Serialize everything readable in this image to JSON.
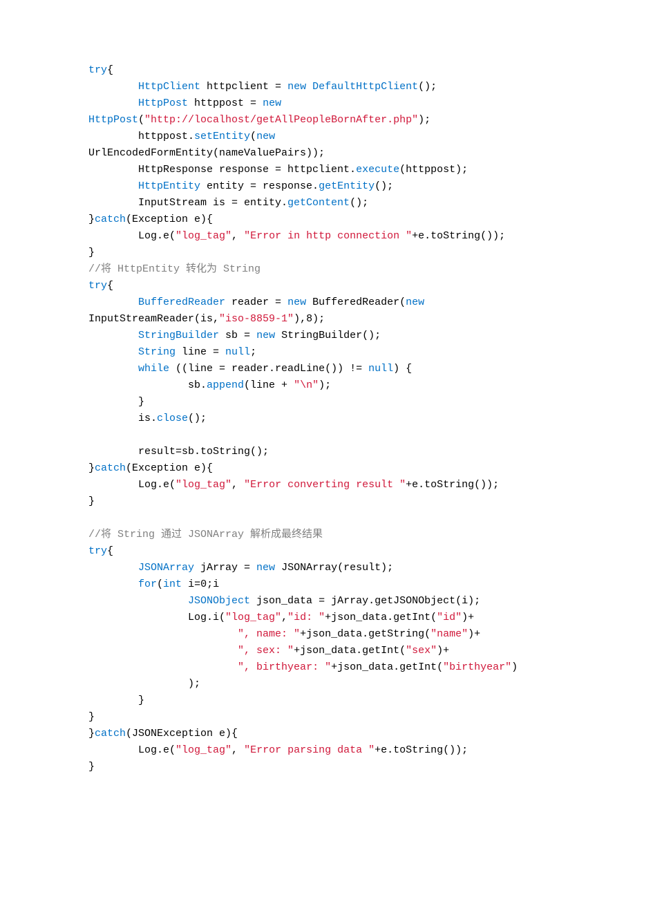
{
  "code": {
    "lines": [
      [
        {
          "t": "try",
          "c": "kw"
        },
        {
          "t": "{"
        }
      ],
      [
        {
          "t": "        "
        },
        {
          "t": "HttpClient",
          "c": "kw"
        },
        {
          "t": " httpclient = "
        },
        {
          "t": "new",
          "c": "kw"
        },
        {
          "t": " "
        },
        {
          "t": "DefaultHttpClient",
          "c": "kw"
        },
        {
          "t": "();"
        }
      ],
      [
        {
          "t": "        "
        },
        {
          "t": "HttpPost",
          "c": "kw"
        },
        {
          "t": " httppost = "
        },
        {
          "t": "new",
          "c": "kw"
        }
      ],
      [
        {
          "t": "HttpPost",
          "c": "kw"
        },
        {
          "t": "("
        },
        {
          "t": "\"http://localhost/getAllPeopleBornAfter.php\"",
          "c": "str"
        },
        {
          "t": ");"
        }
      ],
      [
        {
          "t": "        httppost."
        },
        {
          "t": "setEntity",
          "c": "kw"
        },
        {
          "t": "("
        },
        {
          "t": "new",
          "c": "kw"
        }
      ],
      [
        {
          "t": "UrlEncodedFormEntity(nameValuePairs));"
        }
      ],
      [
        {
          "t": "        HttpResponse response = httpclient."
        },
        {
          "t": "execute",
          "c": "kw"
        },
        {
          "t": "(httppost);"
        }
      ],
      [
        {
          "t": "        "
        },
        {
          "t": "HttpEntity",
          "c": "kw"
        },
        {
          "t": " entity = response."
        },
        {
          "t": "getEntity",
          "c": "kw"
        },
        {
          "t": "();"
        }
      ],
      [
        {
          "t": "        InputStream is = entity."
        },
        {
          "t": "getContent",
          "c": "kw"
        },
        {
          "t": "();"
        }
      ],
      [
        {
          "t": "}"
        },
        {
          "t": "catch",
          "c": "kw"
        },
        {
          "t": "(Exception e){"
        }
      ],
      [
        {
          "t": "        Log.e("
        },
        {
          "t": "\"log_tag\"",
          "c": "str"
        },
        {
          "t": ", "
        },
        {
          "t": "\"Error in http connection \"",
          "c": "str"
        },
        {
          "t": "+e.toString());"
        }
      ],
      [
        {
          "t": "}"
        }
      ],
      [
        {
          "t": "//将 HttpEntity 转化为 String",
          "c": "cmt"
        }
      ],
      [
        {
          "t": "try",
          "c": "kw"
        },
        {
          "t": "{"
        }
      ],
      [
        {
          "t": "        "
        },
        {
          "t": "BufferedReader",
          "c": "kw"
        },
        {
          "t": " reader = "
        },
        {
          "t": "new",
          "c": "kw"
        },
        {
          "t": " BufferedReader("
        },
        {
          "t": "new",
          "c": "kw"
        }
      ],
      [
        {
          "t": "InputStreamReader(is,"
        },
        {
          "t": "\"iso-8859-1\"",
          "c": "str"
        },
        {
          "t": "),8);"
        }
      ],
      [
        {
          "t": "        "
        },
        {
          "t": "StringBuilder",
          "c": "kw"
        },
        {
          "t": " sb = "
        },
        {
          "t": "new",
          "c": "kw"
        },
        {
          "t": " StringBuilder();"
        }
      ],
      [
        {
          "t": "        "
        },
        {
          "t": "String",
          "c": "kw"
        },
        {
          "t": " line = "
        },
        {
          "t": "null",
          "c": "kw"
        },
        {
          "t": ";"
        }
      ],
      [
        {
          "t": "        "
        },
        {
          "t": "while",
          "c": "kw"
        },
        {
          "t": " ((line = reader.readLine()) != "
        },
        {
          "t": "null",
          "c": "kw"
        },
        {
          "t": ") {"
        }
      ],
      [
        {
          "t": "                sb."
        },
        {
          "t": "append",
          "c": "kw"
        },
        {
          "t": "(line + "
        },
        {
          "t": "\"\\n\"",
          "c": "str"
        },
        {
          "t": ");"
        }
      ],
      [
        {
          "t": "        }"
        }
      ],
      [
        {
          "t": "        is."
        },
        {
          "t": "close",
          "c": "kw"
        },
        {
          "t": "();"
        }
      ],
      [
        {
          "t": " "
        }
      ],
      [
        {
          "t": "        result=sb.toString();"
        }
      ],
      [
        {
          "t": "}"
        },
        {
          "t": "catch",
          "c": "kw"
        },
        {
          "t": "(Exception e){"
        }
      ],
      [
        {
          "t": "        Log.e("
        },
        {
          "t": "\"log_tag\"",
          "c": "str"
        },
        {
          "t": ", "
        },
        {
          "t": "\"Error converting result \"",
          "c": "str"
        },
        {
          "t": "+e.toString());"
        }
      ],
      [
        {
          "t": "}"
        }
      ],
      [
        {
          "t": " "
        }
      ],
      [
        {
          "t": "//将 String 通过 JSONArray 解析成最终结果",
          "c": "cmt"
        }
      ],
      [
        {
          "t": "try",
          "c": "kw"
        },
        {
          "t": "{"
        }
      ],
      [
        {
          "t": "        "
        },
        {
          "t": "JSONArray",
          "c": "kw"
        },
        {
          "t": " jArray = "
        },
        {
          "t": "new",
          "c": "kw"
        },
        {
          "t": " JSONArray(result);"
        }
      ],
      [
        {
          "t": "        "
        },
        {
          "t": "for",
          "c": "kw"
        },
        {
          "t": "("
        },
        {
          "t": "int",
          "c": "kw"
        },
        {
          "t": " i=0;i"
        }
      ],
      [
        {
          "t": "                "
        },
        {
          "t": "JSONObject",
          "c": "kw"
        },
        {
          "t": " json_data = jArray.getJSONObject(i);"
        }
      ],
      [
        {
          "t": "                Log.i("
        },
        {
          "t": "\"log_tag\"",
          "c": "str"
        },
        {
          "t": ","
        },
        {
          "t": "\"id: \"",
          "c": "str"
        },
        {
          "t": "+json_data.getInt("
        },
        {
          "t": "\"id\"",
          "c": "str"
        },
        {
          "t": ")+"
        }
      ],
      [
        {
          "t": "                        "
        },
        {
          "t": "\", name: \"",
          "c": "str"
        },
        {
          "t": "+json_data.getString("
        },
        {
          "t": "\"name\"",
          "c": "str"
        },
        {
          "t": ")+"
        }
      ],
      [
        {
          "t": "                        "
        },
        {
          "t": "\", sex: \"",
          "c": "str"
        },
        {
          "t": "+json_data.getInt("
        },
        {
          "t": "\"sex\"",
          "c": "str"
        },
        {
          "t": ")+"
        }
      ],
      [
        {
          "t": "                        "
        },
        {
          "t": "\", birthyear: \"",
          "c": "str"
        },
        {
          "t": "+json_data.getInt("
        },
        {
          "t": "\"birthyear\"",
          "c": "str"
        },
        {
          "t": ")"
        }
      ],
      [
        {
          "t": "                );"
        }
      ],
      [
        {
          "t": "        }"
        }
      ],
      [
        {
          "t": "}"
        }
      ],
      [
        {
          "t": "}"
        },
        {
          "t": "catch",
          "c": "kw"
        },
        {
          "t": "(JSONException e){"
        }
      ],
      [
        {
          "t": "        Log.e("
        },
        {
          "t": "\"log_tag\"",
          "c": "str"
        },
        {
          "t": ", "
        },
        {
          "t": "\"Error parsing data \"",
          "c": "str"
        },
        {
          "t": "+e.toString());"
        }
      ],
      [
        {
          "t": "}"
        }
      ]
    ]
  }
}
